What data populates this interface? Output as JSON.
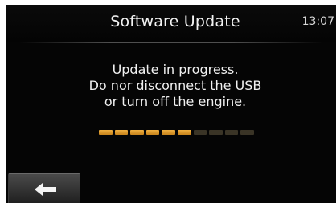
{
  "header": {
    "title": "Software Update",
    "clock": "13:07"
  },
  "message": {
    "line1": "Update in progress.",
    "line2": "Do nor disconnect the USB",
    "line3": "or turn off the engine."
  },
  "progress": {
    "completed_segments": 6,
    "total_segments": 10,
    "fraction": 0.6,
    "color": "#e8a030"
  },
  "back_button": {
    "icon": "arrow-left-icon"
  }
}
